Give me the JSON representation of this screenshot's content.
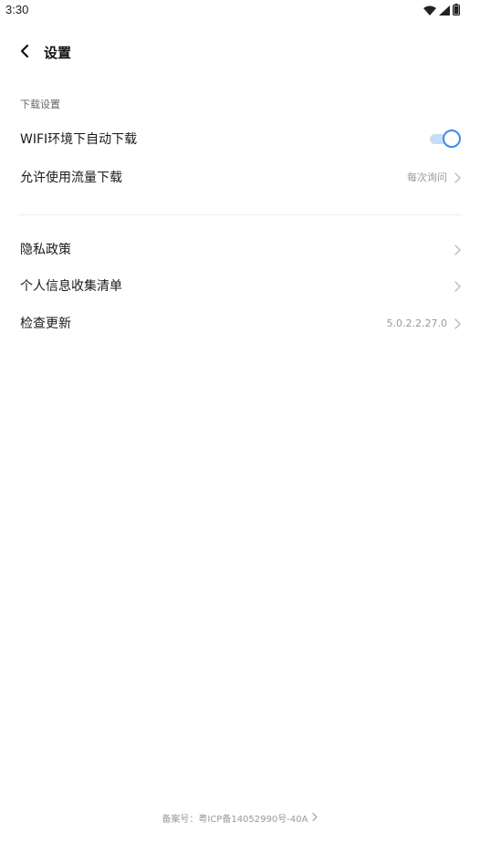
{
  "status_bar": {
    "time": "3:30",
    "icons": [
      "wifi-icon",
      "cellular-signal-icon",
      "battery-icon"
    ]
  },
  "header": {
    "title": "设置",
    "back_icon": "back-arrow-icon"
  },
  "download_section": {
    "title": "下载设置",
    "wifi_auto_download": {
      "label": "WIFI环境下自动下载",
      "enabled": true
    },
    "mobile_data_download": {
      "label": "允许使用流量下载",
      "value": "每次询问"
    }
  },
  "other_section": {
    "items": [
      {
        "label": "隐私政策",
        "value": ""
      },
      {
        "label": "个人信息收集清单",
        "value": ""
      },
      {
        "label": "检查更新",
        "value": "5.0.2.2.27.0"
      }
    ]
  },
  "footer": {
    "icp_text": "备案号：粤ICP备14052990号-40A"
  },
  "colors": {
    "accent": "#3d8bf0",
    "toggle_track": "#c7dcf7",
    "muted_text": "#999999",
    "divider": "#eeeeee"
  }
}
